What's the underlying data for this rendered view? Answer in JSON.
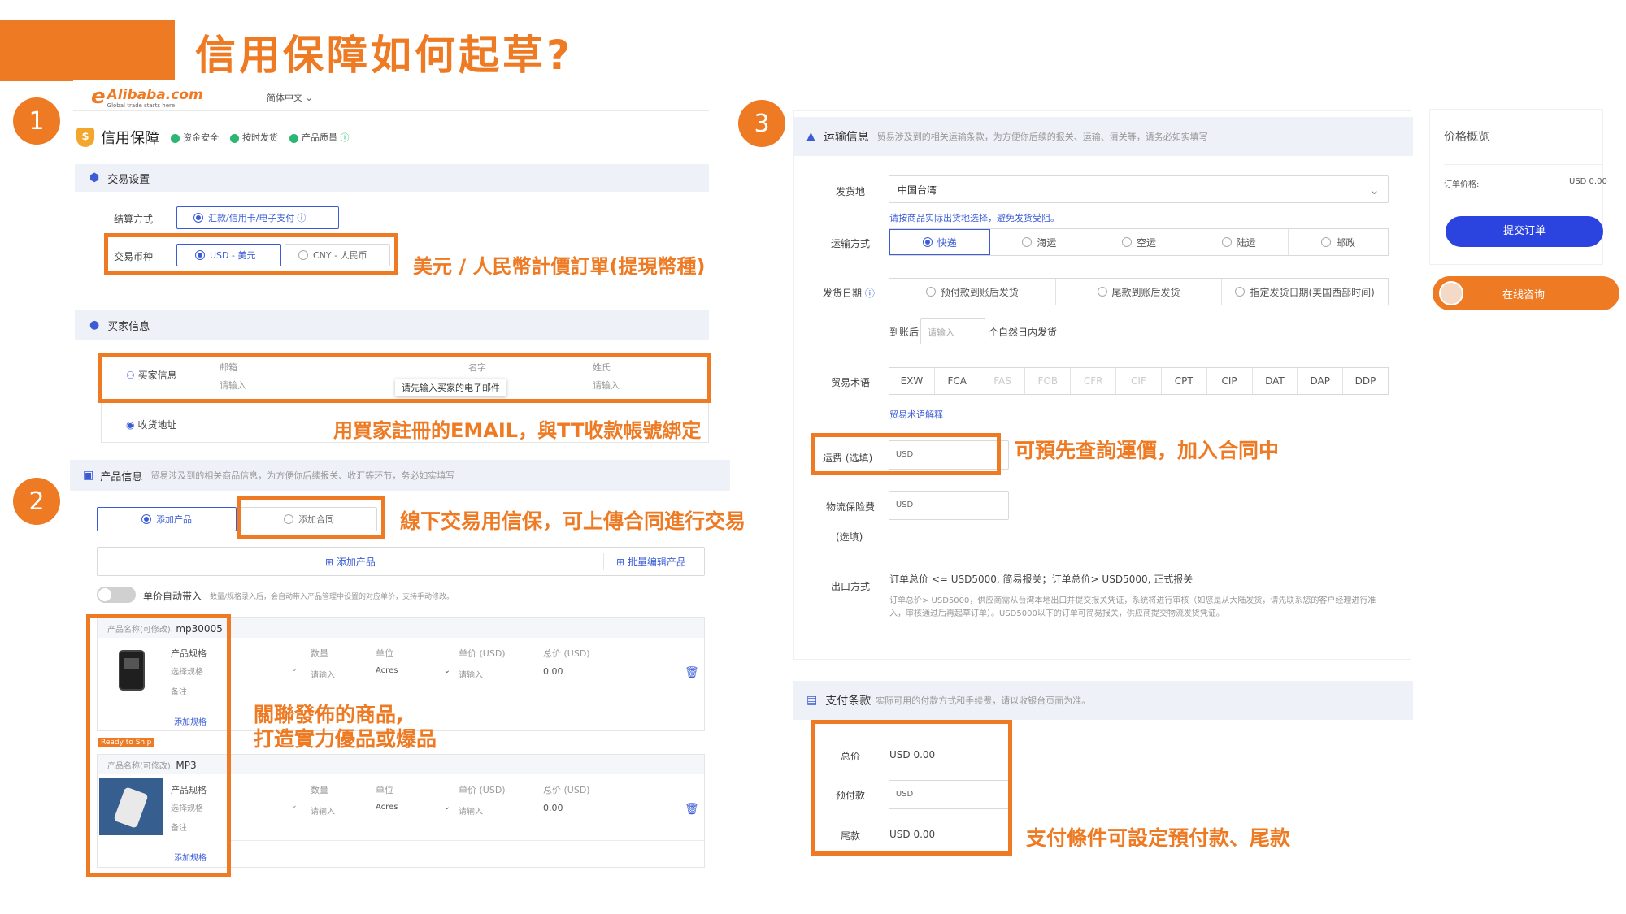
{
  "title": "信用保障如何起草?",
  "steps": [
    "1",
    "2",
    "3"
  ],
  "header": {
    "logo_text": "Alibaba.com",
    "logo_sub": "Global trade starts here",
    "language": "简体中文"
  },
  "credit": {
    "title": "信用保障",
    "badges": [
      "资金安全",
      "按时发货",
      "产品质量"
    ],
    "trade_settings": "交易设置",
    "settlement_label": "结算方式",
    "settlement_value": "汇款/信用卡/电子支付",
    "currency_label": "交易币种",
    "currency_usd": "USD - 美元",
    "currency_cny": "CNY - 人民币",
    "buyer_section": "买家信息",
    "buyer_info": "买家信息",
    "email_label": "邮箱",
    "email_placeholder": "请输入",
    "email_tooltip": "请先输入买家的电子邮件",
    "first_name_label": "名字",
    "last_name_label": "姓氏",
    "last_name_placeholder": "请输入",
    "address_label": "收货地址"
  },
  "product": {
    "section": "产品信息",
    "section_desc": "贸易涉及到的相关商品信息，为方便你后续报关、收汇等环节，务必如实填写",
    "add_product_tab": "添加产品",
    "add_contract_tab": "添加合同",
    "add_product_btn": "添加产品",
    "batch_edit_btn": "批量编辑产品",
    "auto_price_label": "单价自动带入",
    "auto_price_desc": "数量/规格录入后，会自动带入产品管理中设置的对应单价，支持手动修改。",
    "items": [
      {
        "name_label": "产品名称(可修改):",
        "name": "mp30005",
        "spec": "产品规格",
        "spec_placeholder": "选择规格",
        "remark": "备注",
        "add_spec": "添加规格",
        "qty_label": "数量",
        "qty_placeholder": "请输入",
        "unit_label": "单位",
        "unit": "Acres",
        "price_label": "单价 (USD)",
        "price_placeholder": "请输入",
        "total_label": "总价 (USD)",
        "total": "0.00"
      },
      {
        "name_label": "产品名称(可修改):",
        "name": "MP3",
        "spec": "产品规格",
        "spec_placeholder": "选择规格",
        "remark": "备注",
        "add_spec": "添加规格",
        "qty_label": "数量",
        "qty_placeholder": "请输入",
        "unit_label": "单位",
        "unit": "Acres",
        "price_label": "单价 (USD)",
        "price_placeholder": "请输入",
        "total_label": "总价 (USD)",
        "total": "0.00"
      }
    ],
    "ready_badge": "Ready to Ship"
  },
  "shipping": {
    "section": "运输信息",
    "section_desc": "贸易涉及到的相关运输条款，为方便你后续的报关、运输、清关等，请务必如实填写",
    "origin_label": "发货地",
    "origin_value": "中国台湾",
    "origin_hint": "请按商品实际出货地选择，避免发货受阻。",
    "method_label": "运输方式",
    "methods": [
      "快递",
      "海运",
      "空运",
      "陆运",
      "邮政"
    ],
    "date_label": "发货日期",
    "date_options": [
      "预付款到账后发货",
      "尾款到账后发货",
      "指定发货日期(美国西部时间)"
    ],
    "after_label": "到账后",
    "after_placeholder": "请输入",
    "after_suffix": "个自然日内发货",
    "term_label": "贸易术语",
    "terms": [
      "EXW",
      "FCA",
      "FAS",
      "FOB",
      "CFR",
      "CIF",
      "CPT",
      "CIP",
      "DAT",
      "DAP",
      "DDP"
    ],
    "term_link": "贸易术语解释",
    "freight_label": "运费 (选填)",
    "currency": "USD",
    "insurance_label": "物流保险费",
    "insurance_opt": "(选填)",
    "export_label": "出口方式",
    "export_text": "订单总价 <= USD5000, 简易报关；订单总价> USD5000, 正式报关",
    "export_note": "订单总价> USD5000，供应商需从台湾本地出口并提交报关凭证，系统将进行审核（如您是从大陆发货，请先联系您的客户经理进行准入，审核通过后再起草订单）。USD5000以下的订单可简易报关，供应商提交物流发货凭证。"
  },
  "price_summary": {
    "title": "价格概览",
    "order_price_label": "订单价格:",
    "order_price": "USD 0.00",
    "submit": "提交订单",
    "consult": "在线咨询"
  },
  "payment": {
    "section": "支付条款",
    "section_desc": "实际可用的付款方式和手续费，请以收银台页面为准。",
    "total_label": "总价",
    "total": "USD 0.00",
    "deposit_label": "预付款",
    "currency": "USD",
    "balance_label": "尾款",
    "balance": "USD 0.00"
  },
  "notes": {
    "currency": "美元 / 人民幣計價訂單(提現幣種)",
    "email": "用買家註冊的EMAIL，與TT收款帳號綁定",
    "contract": "線下交易用信保，可上傳合同進行交易",
    "product_1": "關聯發佈的商品,",
    "product_2": "打造實力優品或爆品",
    "freight": "可預先查詢運價，加入合同中",
    "payment": "支付條件可設定預付款、尾款"
  },
  "colors": {
    "accent": "#ee7a23",
    "primary": "#3b5cd6",
    "section_bg": "#eef1f8"
  }
}
